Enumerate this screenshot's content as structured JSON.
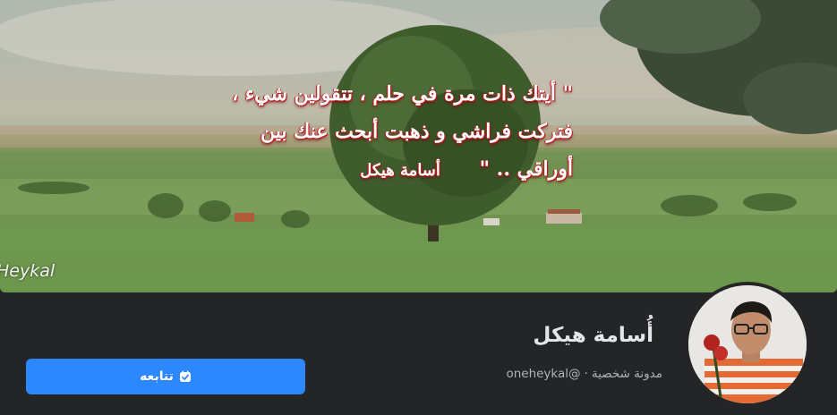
{
  "cover": {
    "quote_lines": [
      "\" أيتك ذات مرة في حلم ، تتقولين شيء ،",
      "فتركت فراشي و ذهبت أبحث عنك بين",
      "أوراقي .. \""
    ],
    "signature": "أسامة هيكل",
    "watermark": "Heykal"
  },
  "profile": {
    "name": "أُسامة هيكل",
    "category": "مدونة شخصية",
    "separator": "·",
    "handle": "@oneheykal"
  },
  "actions": {
    "follow_label": "تتابعه",
    "follow_icon": "check-square-icon"
  },
  "colors": {
    "background": "#242526",
    "button": "#2d88ff",
    "name_text": "#e4e6eb",
    "meta_text": "#b0b3b8"
  }
}
